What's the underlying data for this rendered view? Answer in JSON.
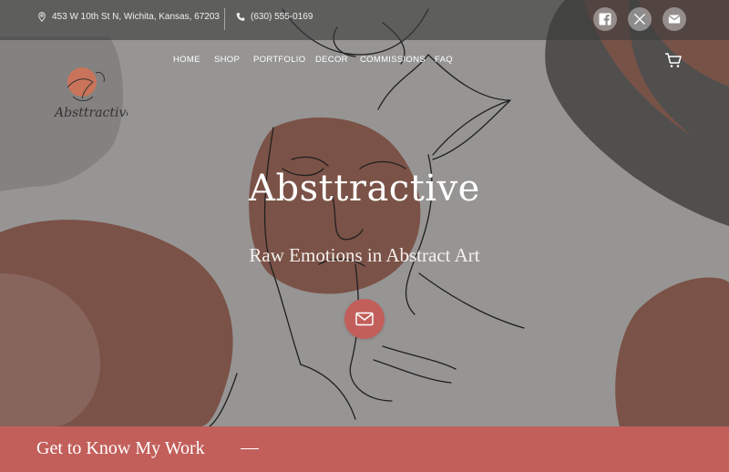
{
  "topbar": {
    "address": "453 W 10th St N, Wichita, Kansas, 67203",
    "phone": "(630) 555-0169"
  },
  "social": {
    "icons": [
      "facebook-icon",
      "x-icon",
      "mail-icon"
    ]
  },
  "nav": {
    "items": [
      "HOME",
      "SHOP",
      "PORTFOLIO",
      "DECOR",
      "COMMISSIONS",
      "FAQ"
    ]
  },
  "logo": {
    "text": "Absttractive"
  },
  "hero": {
    "title": "Absttractive",
    "subtitle": "Raw Emotions in Abstract Art"
  },
  "section": {
    "title": "Get to Know My Work"
  },
  "colors": {
    "background": "#969594",
    "accent": "#c25f5b",
    "brown": "#7b5247",
    "dark": "#4f4d4c"
  }
}
